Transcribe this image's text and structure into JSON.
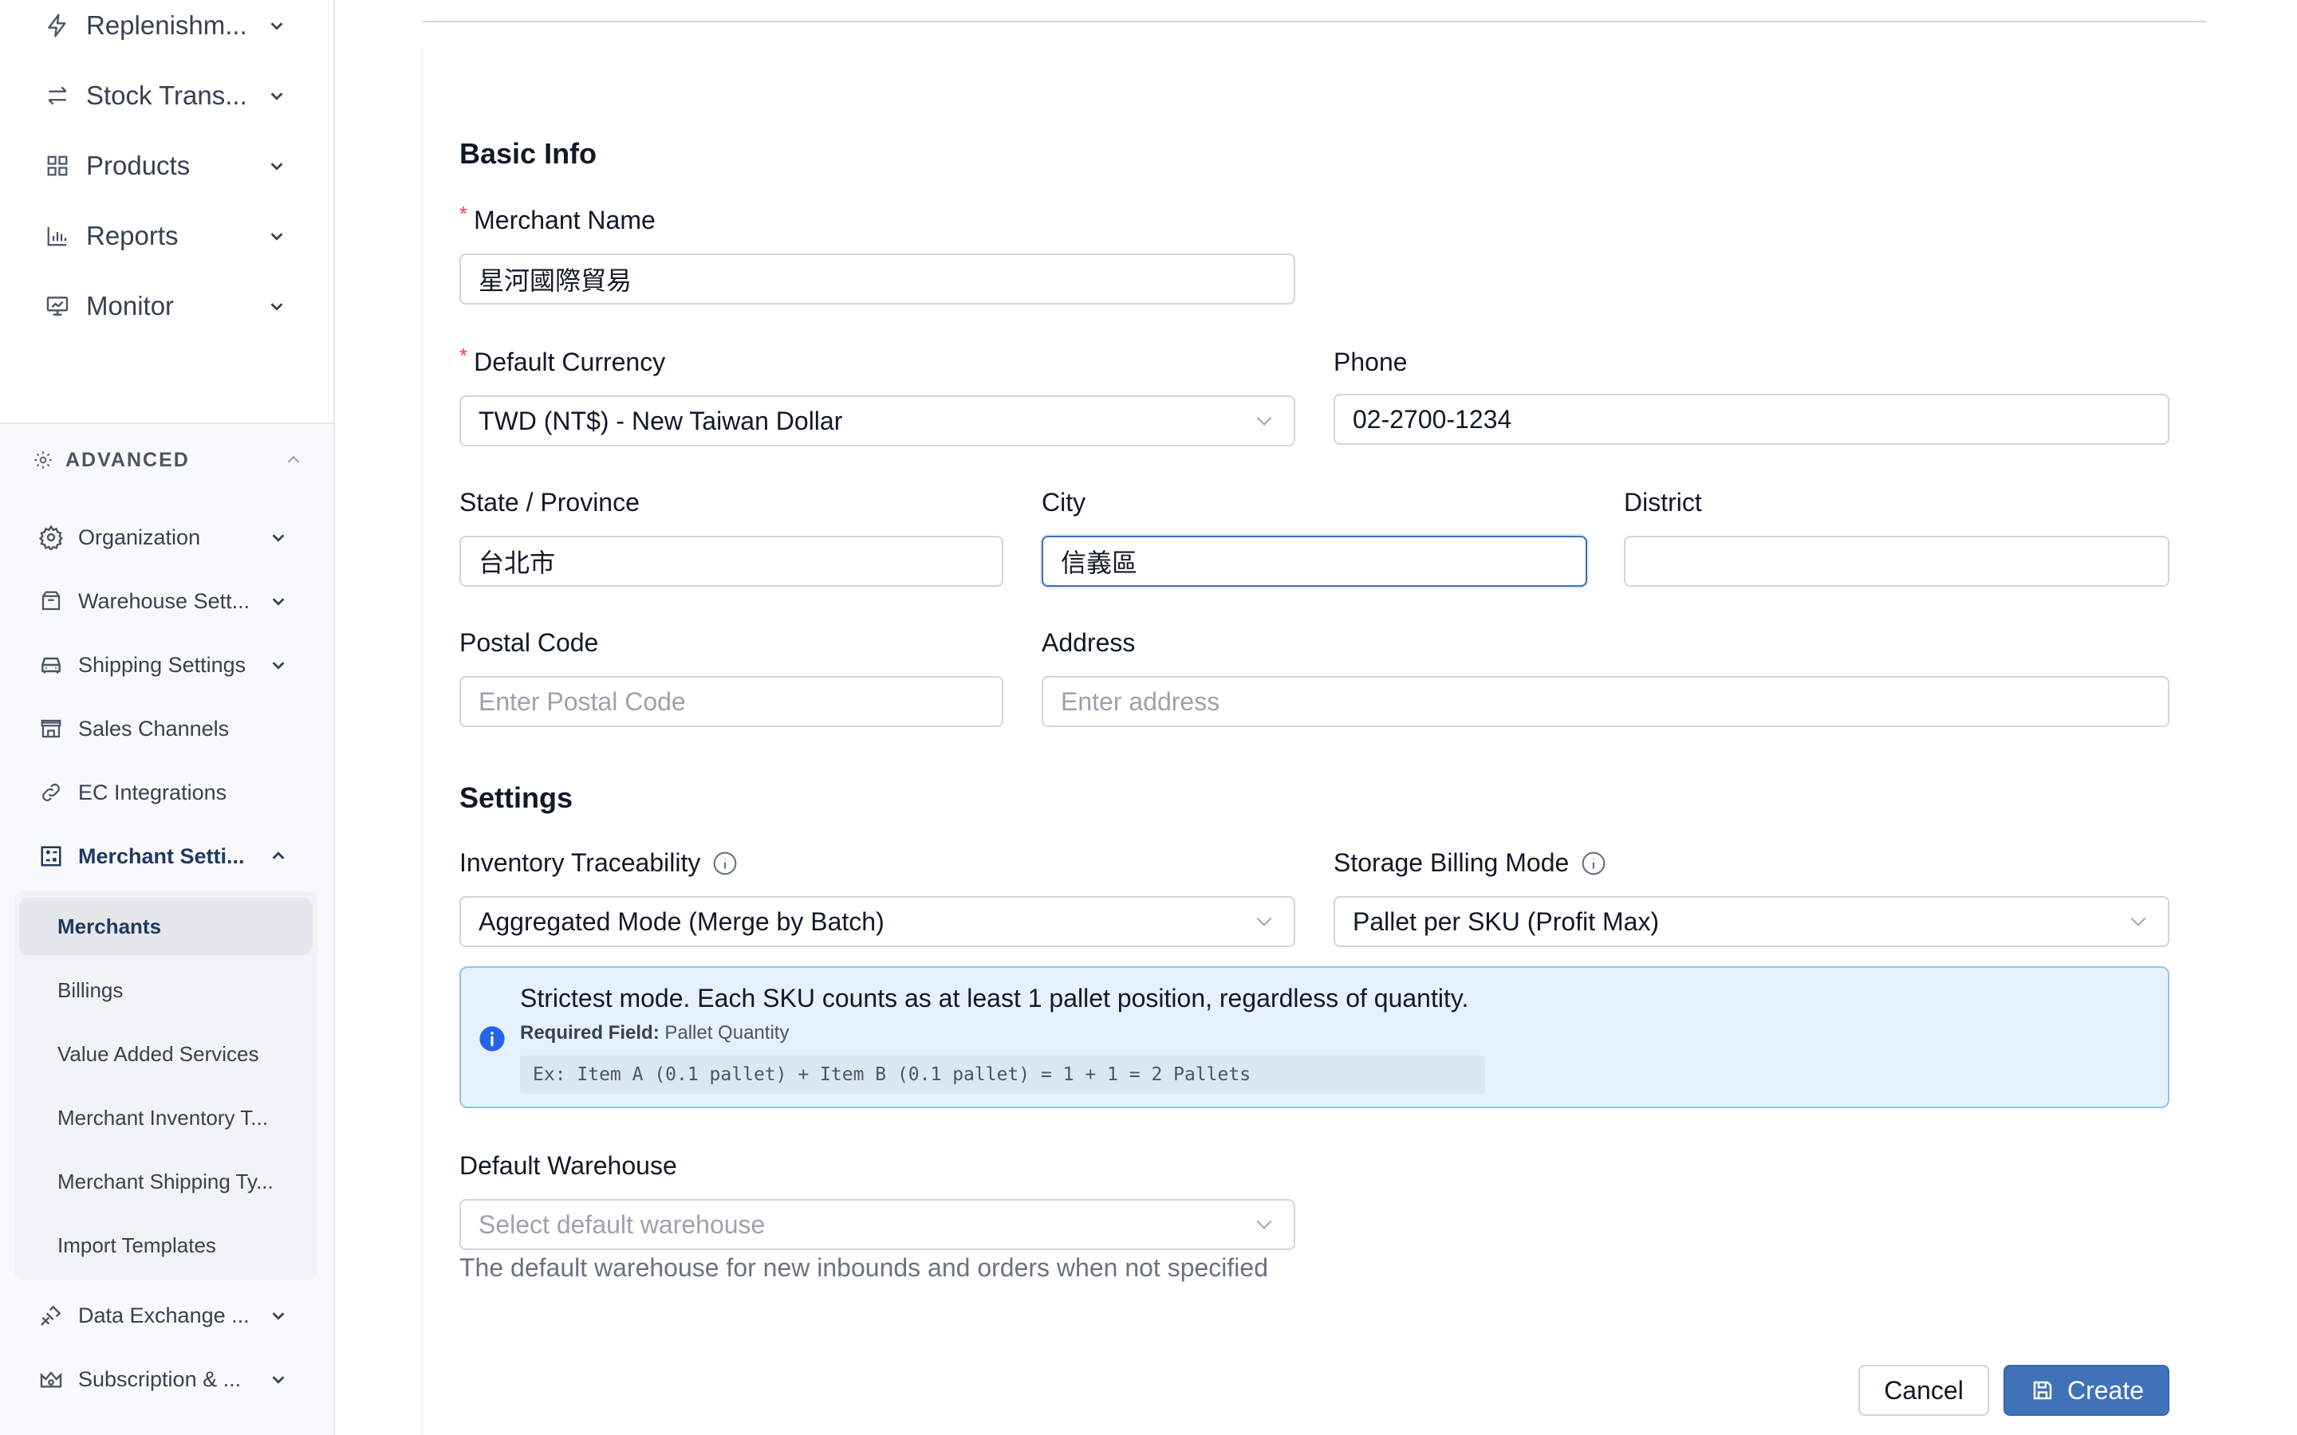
{
  "sidebar": {
    "top_items": [
      {
        "label": "Replenishm...",
        "icon": "lightning-icon"
      },
      {
        "label": "Stock Trans...",
        "icon": "transfer-arrows-icon"
      },
      {
        "label": "Products",
        "icon": "grid-icon"
      },
      {
        "label": "Reports",
        "icon": "bar-chart-icon"
      },
      {
        "label": "Monitor",
        "icon": "presentation-icon"
      }
    ],
    "advanced": {
      "title": "ADVANCED",
      "icon": "gear-icon",
      "items": [
        {
          "label": "Organization",
          "icon": "gear-icon"
        },
        {
          "label": "Warehouse Sett...",
          "icon": "inbox-icon"
        },
        {
          "label": "Shipping Settings",
          "icon": "car-icon"
        },
        {
          "label": "Sales Channels",
          "icon": "store-icon"
        },
        {
          "label": "EC Integrations",
          "icon": "link-icon"
        },
        {
          "label": "Merchant Setti...",
          "icon": "calculator-icon"
        }
      ],
      "merchant_children": [
        {
          "label": "Merchants",
          "active": true
        },
        {
          "label": "Billings"
        },
        {
          "label": "Value Added Services"
        },
        {
          "label": "Merchant Inventory T..."
        },
        {
          "label": "Merchant Shipping Ty..."
        },
        {
          "label": "Import Templates"
        }
      ],
      "bottom_items": [
        {
          "label": "Data Exchange ...",
          "icon": "satellite-icon"
        },
        {
          "label": "Subscription & ...",
          "icon": "crown-icon"
        }
      ]
    }
  },
  "form": {
    "basic_info_title": "Basic Info",
    "merchant_name": {
      "label": "Merchant Name",
      "value": "星河國際貿易"
    },
    "default_currency": {
      "label": "Default Currency",
      "value": "TWD (NT$) - New Taiwan Dollar"
    },
    "phone": {
      "label": "Phone",
      "value": "02-2700-1234"
    },
    "state": {
      "label": "State / Province",
      "value": "台北市"
    },
    "city": {
      "label": "City",
      "value": "信義區"
    },
    "district": {
      "label": "District",
      "value": ""
    },
    "postal_code": {
      "label": "Postal Code",
      "placeholder": "Enter Postal Code"
    },
    "address": {
      "label": "Address",
      "placeholder": "Enter address"
    },
    "settings_title": "Settings",
    "inventory_traceability": {
      "label": "Inventory Traceability",
      "value": "Aggregated Mode (Merge by Batch)"
    },
    "storage_billing_mode": {
      "label": "Storage Billing Mode",
      "value": "Pallet per SKU (Profit Max)"
    },
    "info": {
      "text": "Strictest mode. Each SKU counts as at least 1 pallet position, regardless of quantity.",
      "required_label": "Required Field:",
      "required_value": " Pallet Quantity",
      "example": "Ex: Item A (0.1 pallet) + Item B (0.1 pallet) = 1 + 1 = 2 Pallets"
    },
    "default_warehouse": {
      "label": "Default Warehouse",
      "placeholder": "Select default warehouse",
      "help": "The default warehouse for new inbounds and orders when not specified"
    },
    "cancel_label": "Cancel",
    "create_label": "Create"
  },
  "colors": {
    "primary": "#3f72b8",
    "info_bg": "#e6f2fb",
    "info_border": "#8ec5ea",
    "required": "#ef4444"
  }
}
